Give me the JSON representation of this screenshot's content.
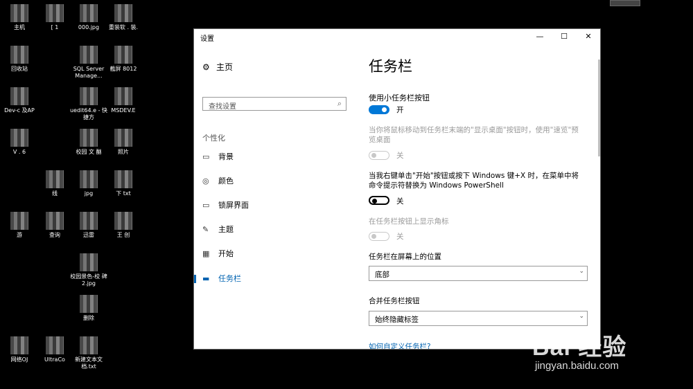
{
  "desktop": {
    "icons": [
      {
        "label": "主机"
      },
      {
        "label": "[ 1"
      },
      {
        "label": "000.jpg"
      },
      {
        "label": "重装软 . 装."
      },
      {
        "label": "回收站"
      },
      {
        "label": "SQL Server Manage..."
      },
      {
        "label": "截屏 8012"
      },
      {
        "label": "Dev-c 及AP"
      },
      {
        "label": "uedit64.e - 快捷方"
      },
      {
        "label": "MSDEV.E"
      },
      {
        "label": "V . 6"
      },
      {
        "label": "校园 文 酗"
      },
      {
        "label": "照片"
      },
      {
        "label": "线"
      },
      {
        "label": "jpg"
      },
      {
        "label": "下 txt"
      },
      {
        "label": "游"
      },
      {
        "label": "查询"
      },
      {
        "label": "迅雷"
      },
      {
        "label": "王 创"
      },
      {
        "label": "校园景色-校 碑2.jpg"
      },
      {
        "label": "删除"
      },
      {
        "label": "网络OJ"
      },
      {
        "label": "UltraCo"
      },
      {
        "label": "新建文本文 档.txt"
      }
    ]
  },
  "window": {
    "title": "设置",
    "min_label": "—",
    "max_label": "☐",
    "close_label": "✕"
  },
  "sidebar": {
    "home_label": "主页",
    "search_placeholder": "查找设置",
    "section_label": "个性化",
    "items": [
      {
        "label": "背景",
        "icon": "picture-icon",
        "glyph": "▭"
      },
      {
        "label": "颜色",
        "icon": "palette-icon",
        "glyph": "◎"
      },
      {
        "label": "锁屏界面",
        "icon": "lockscreen-icon",
        "glyph": "▭"
      },
      {
        "label": "主题",
        "icon": "theme-brush-icon",
        "glyph": "✎"
      },
      {
        "label": "开始",
        "icon": "start-tiles-icon",
        "glyph": "▦"
      },
      {
        "label": "任务栏",
        "icon": "taskbar-icon",
        "glyph": "▬"
      }
    ],
    "active_index": 5
  },
  "main": {
    "page_title": "任务栏",
    "clipped_label": "使用小任务栏按钮",
    "small_buttons": {
      "state": "开",
      "on": true
    },
    "peek_label": "当你将鼠标移动到任务栏末端的\"显示桌面\"按钮时，使用\"速览\"预览桌面",
    "peek": {
      "state": "关",
      "on": false,
      "disabled": true
    },
    "powershell_label": "当我右键单击\"开始\"按钮或按下 Windows 键+X 时，在菜单中将命令提示符替换为 Windows PowerShell",
    "powershell": {
      "state": "关",
      "on": false,
      "disabled": false
    },
    "badges_label": "在任务栏按钮上显示角标",
    "badges": {
      "state": "关",
      "on": false,
      "disabled": true
    },
    "position_label": "任务栏在屏幕上的位置",
    "position_value": "底部",
    "combine_label": "合并任务栏按钮",
    "combine_value": "始终隐藏标签",
    "help_link": "如何自定义任务栏?"
  },
  "watermark": {
    "brand": "Bai 经验",
    "url": "jingyan.baidu.com"
  }
}
